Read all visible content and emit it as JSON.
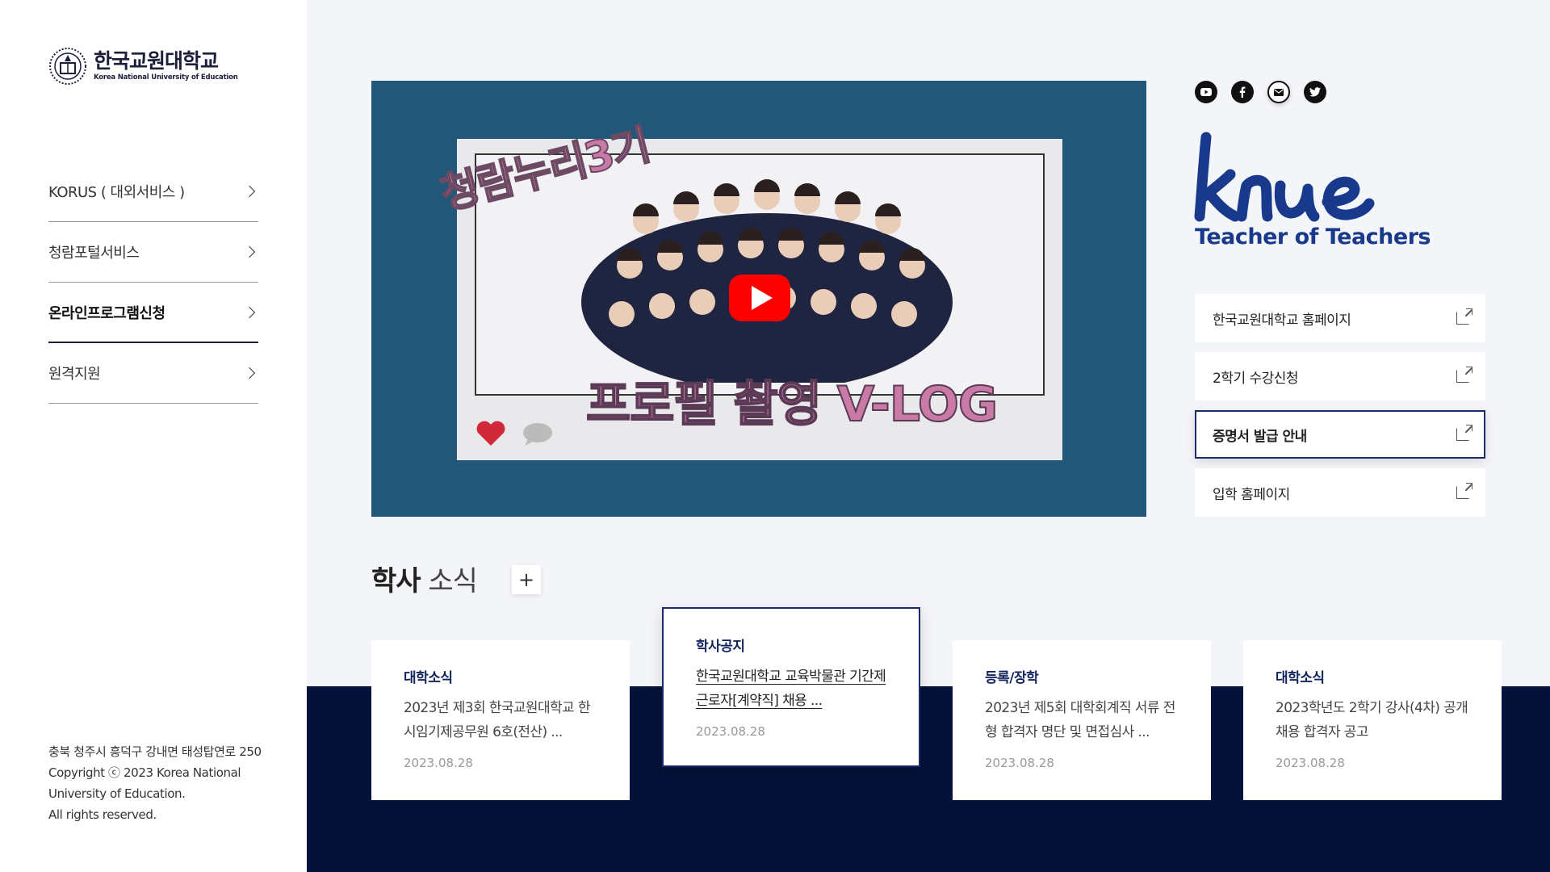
{
  "brand": {
    "name_ko": "한국교원대학교",
    "name_en": "Korea National University of Education",
    "tagline": "Teacher of Teachers",
    "wordmark": "knue"
  },
  "sidebar": {
    "items": [
      {
        "label": "KORUS ( 대외서비스 )"
      },
      {
        "label": "청람포털서비스"
      },
      {
        "label": "온라인프로그램신청"
      },
      {
        "label": "원격지원"
      }
    ],
    "footer": {
      "address": "충북 청주시 흥덕구 강내면 태성탑연로 250",
      "copyright_1": "Copyright ⓒ 2023 Korea National",
      "copyright_2": "University of Education.",
      "rights": "All rights reserved."
    }
  },
  "video": {
    "overlay_title_1": "청람누리3기",
    "overlay_title_2": "프로필 촬영 V-LOG"
  },
  "social": {
    "icons": [
      "youtube-icon",
      "facebook-icon",
      "mail-icon",
      "twitter-icon"
    ]
  },
  "quick_links": [
    {
      "label": "한국교원대학교 홈페이지"
    },
    {
      "label": "2학기 수강신청"
    },
    {
      "label": "증명서 발급 안내"
    },
    {
      "label": "입학 홈페이지"
    }
  ],
  "news": {
    "heading_bold": "학사",
    "heading_light": "소식",
    "more_label": "+",
    "cards": [
      {
        "category": "대학소식",
        "title": "2023년 제3회 한국교원대학교 한시임기제공무원 6호(전산) ...",
        "date": "2023.08.28"
      },
      {
        "category": "학사공지",
        "title": "한국교원대학교 교육박물관 기간제 근로자[계약직] 채용 ...",
        "date": "2023.08.28"
      },
      {
        "category": "등록/장학",
        "title": "2023년 제5회 대학회계직 서류 전형 합격자 명단 및 면접심사 ...",
        "date": "2023.08.28"
      },
      {
        "category": "대학소식",
        "title": "2023학년도 2학기 강사(4차) 공개 채용 합격자 공고",
        "date": "2023.08.28"
      }
    ]
  },
  "colors": {
    "navy": "#04123a",
    "accent": "#1b2a6b",
    "knue_blue": "#193a8c",
    "video_bg": "#23577a",
    "play_red": "#ff0000"
  }
}
